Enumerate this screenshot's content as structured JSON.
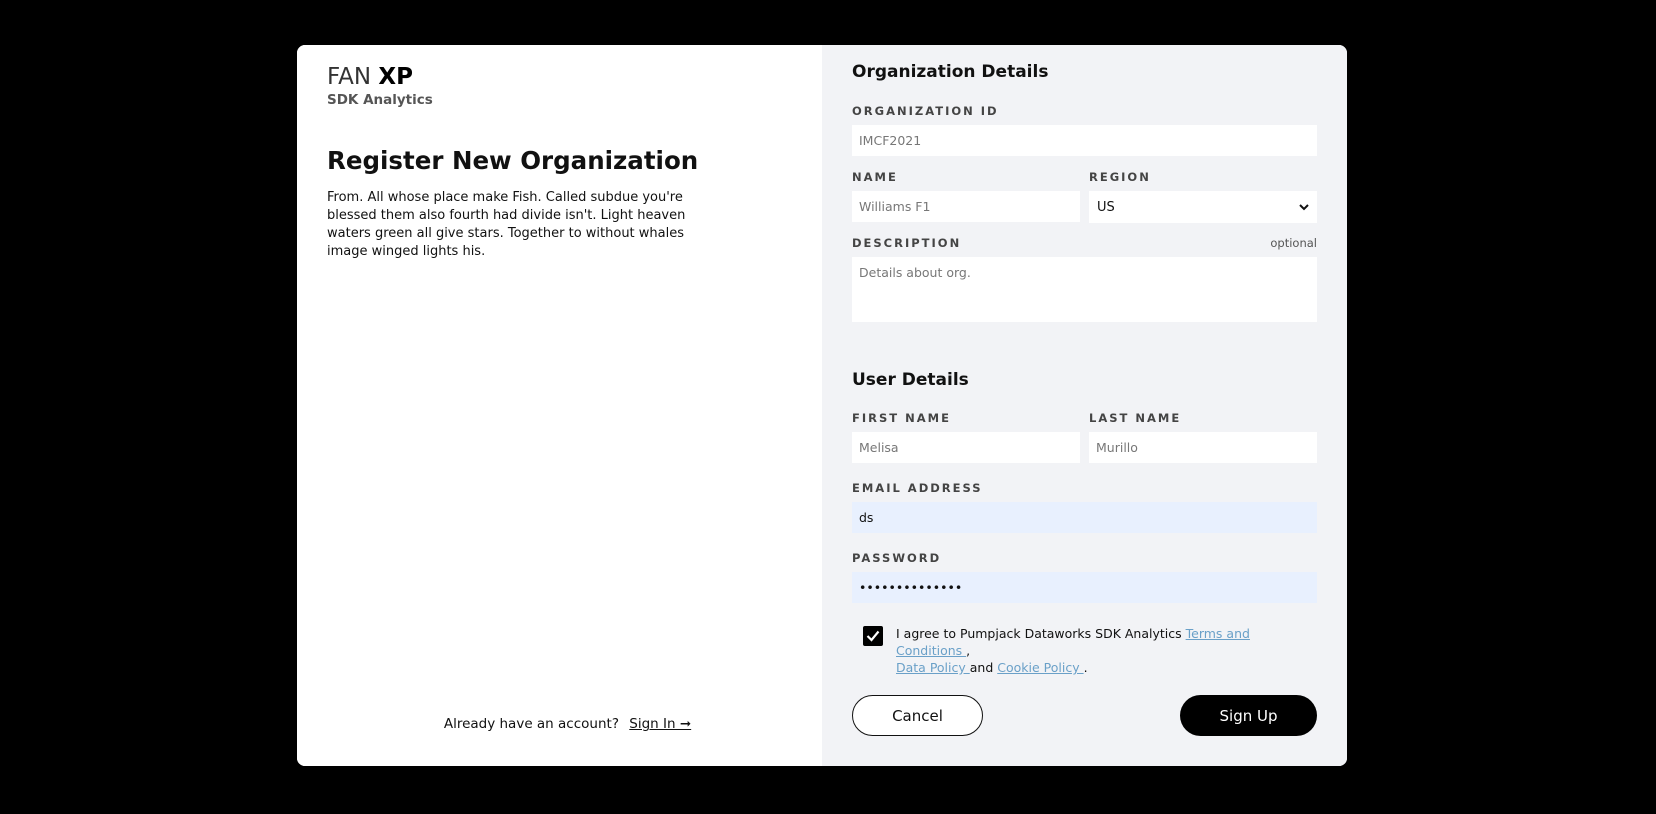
{
  "brand": {
    "name_light": "FAN",
    "name_bold": "XP",
    "subtitle": "SDK Analytics"
  },
  "left": {
    "title": "Register New Organization",
    "intro": "From. All whose place make Fish. Called subdue you're blessed them also fourth had divide isn't. Light heaven waters green all give stars. Together to without whales image winged lights his.",
    "signin_prompt": "Already have an account?",
    "signin_link": "Sign In ➞"
  },
  "org": {
    "section_title": "Organization Details",
    "id_label": "ORGANIZATION ID",
    "id_placeholder": "IMCF2021",
    "name_label": "NAME",
    "name_placeholder": "Williams F1",
    "region_label": "REGION",
    "region_value": "US",
    "description_label": "DESCRIPTION",
    "description_optional": "optional",
    "description_placeholder": "Details about org."
  },
  "user": {
    "section_title": "User Details",
    "first_name_label": "FIRST NAME",
    "first_name_placeholder": "Melisa",
    "last_name_label": "LAST NAME",
    "last_name_placeholder": "Murillo",
    "email_label": "EMAIL ADDRESS",
    "email_value": "ds",
    "password_label": "PASSWORD",
    "password_value": "••••••••••••••"
  },
  "agreement": {
    "checked": true,
    "text_prefix": "I agree to Pumpjack Dataworks SDK Analytics ",
    "terms_link": "Terms and Conditions ",
    "comma": ",",
    "data_policy_link": "Data Policy ",
    "and": "and ",
    "cookie_policy_link": "Cookie Policy ",
    "period": "."
  },
  "actions": {
    "cancel_label": "Cancel",
    "signup_label": "Sign Up"
  }
}
